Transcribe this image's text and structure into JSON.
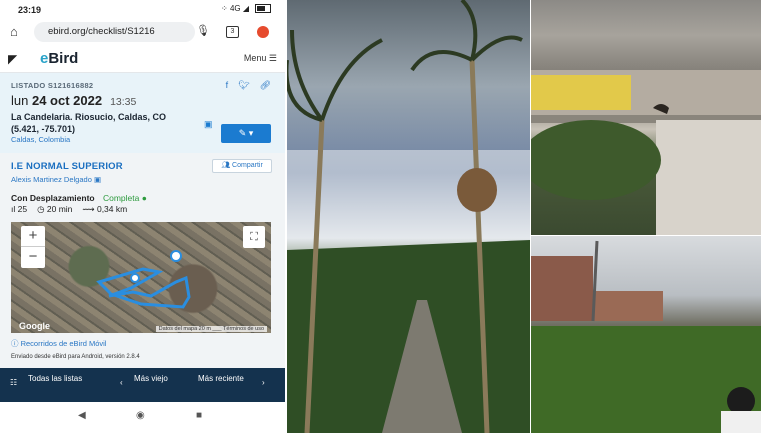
{
  "statusbar": {
    "time": "23:19",
    "signal": "4G",
    "icons_right": "⁘ 4G ◢"
  },
  "browser": {
    "url": "ebird.org/checklist/S1216",
    "tab_count": "3"
  },
  "app": {
    "logo": "eBird",
    "menu_label": "Menu ☰"
  },
  "checklist": {
    "listado": "LISTADO S121616882",
    "date_prefix": "lun ",
    "date": "24 oct 2022",
    "time": "13:35",
    "location_line1": "La Candelaria. Riosucio, Caldas, CO",
    "location_line2": "(5.421, -75.701)",
    "region": "Caldas, Colombia",
    "edit_label": "✎ ▾"
  },
  "details": {
    "title": "I.E NORMAL SUPERIOR",
    "share_label": "Compartir",
    "observer": "Alexis Martinez Delgado",
    "protocol": "Con Desplazamiento",
    "status": "Completa",
    "species_count": "25",
    "duration": "20 min",
    "distance": "0,34 km",
    "map_attribution": "Datos del mapa  20 m ___  Términos de uso",
    "google": "Google",
    "recorridos": "Recorridos de eBird Móvil",
    "enviado": "Enviado desde eBird para Android, versión 2.8.4"
  },
  "bottomnav": {
    "all_lists": "Todas las listas",
    "older": "Más viejo",
    "newer": "Más reciente"
  },
  "colors": {
    "accent": "#1b7bd0",
    "nav_bg": "#14324e",
    "header_bg": "#e8f3f9"
  }
}
